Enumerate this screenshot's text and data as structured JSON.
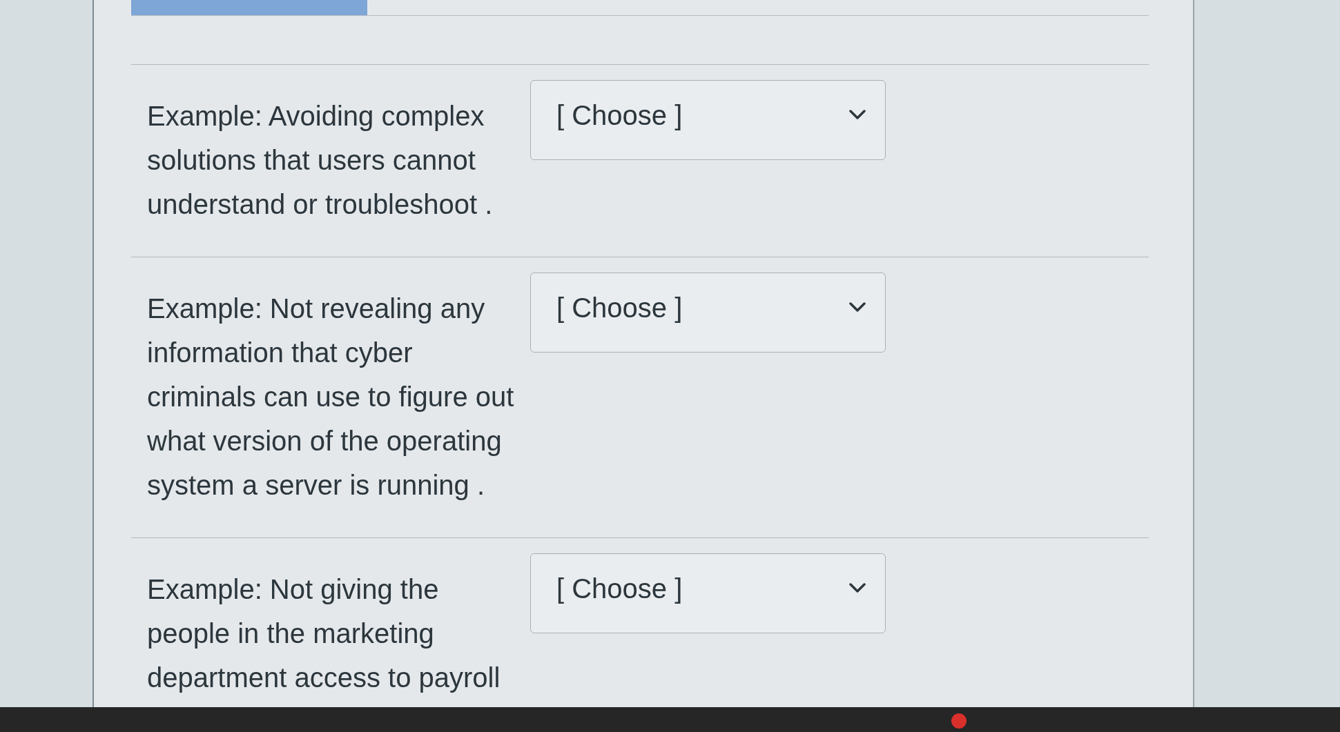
{
  "questions": [
    {
      "text": "Example: Avoiding complex solutions that users cannot understand or troubleshoot .",
      "dropdown": {
        "value": "[ Choose ]"
      }
    },
    {
      "text": "Example: Not revealing any information that cyber criminals can use to figure out what version of the operating system a server is running .",
      "dropdown": {
        "value": "[ Choose ]"
      }
    },
    {
      "text": "Example: Not giving the people in the marketing department access to payroll",
      "dropdown": {
        "value": "[ Choose ]"
      }
    }
  ]
}
